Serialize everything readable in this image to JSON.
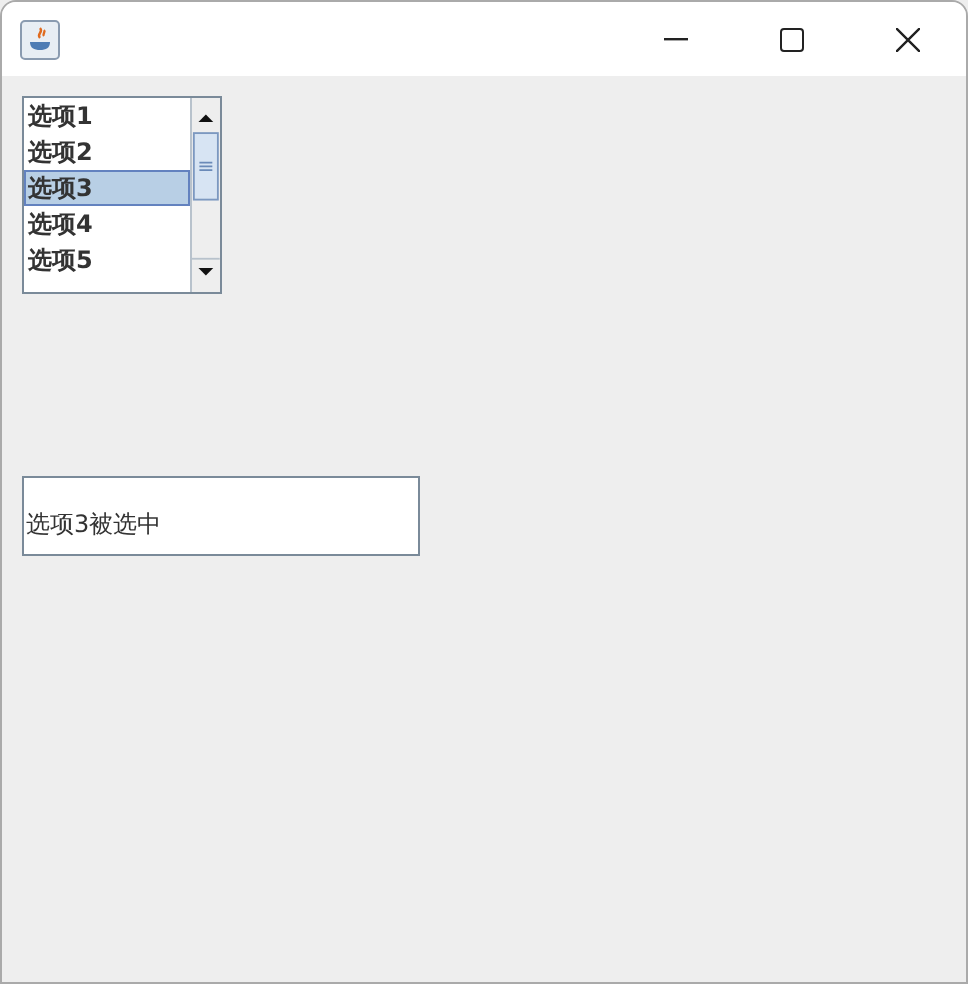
{
  "list": {
    "items": [
      {
        "label": "选项1",
        "selected": false
      },
      {
        "label": "选项2",
        "selected": false
      },
      {
        "label": "选项3",
        "selected": true
      },
      {
        "label": "选项4",
        "selected": false
      },
      {
        "label": "选项5",
        "selected": false
      }
    ]
  },
  "status_field": {
    "value": "选项3被选中"
  }
}
